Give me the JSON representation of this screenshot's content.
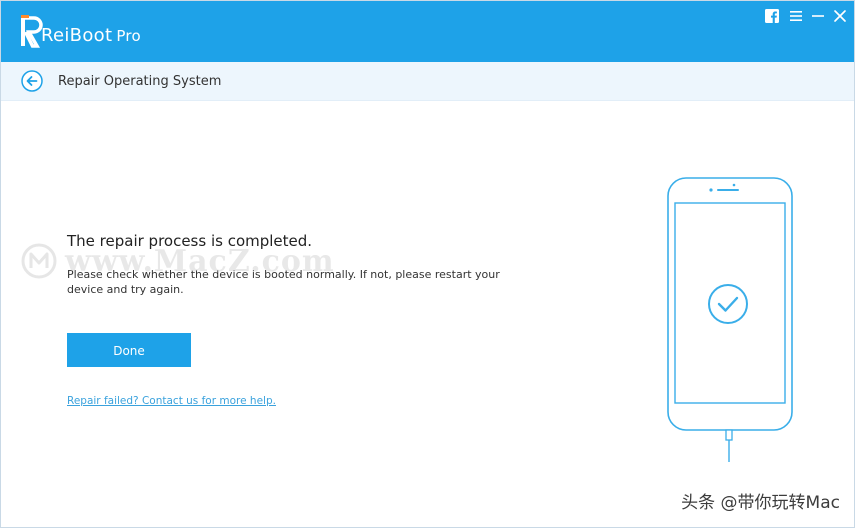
{
  "app": {
    "name": "ReiBoot",
    "edition": "Pro"
  },
  "window_controls": [
    {
      "name": "facebook-icon"
    },
    {
      "name": "menu-icon"
    },
    {
      "name": "minimize-icon"
    },
    {
      "name": "close-icon"
    }
  ],
  "header": {
    "back_icon": "arrow-left-icon",
    "title": "Repair Operating System"
  },
  "main": {
    "heading": "The repair process is completed.",
    "description": "Please check whether the device is booted normally. If not, please restart your device and try again.",
    "done_label": "Done",
    "help_link": "Repair failed? Contact us for more help."
  },
  "illustration": {
    "device": "phone",
    "status_icon": "check-circle-icon"
  },
  "watermarks": {
    "macz": "www.MacZ.com",
    "toutiao": "头条 @带你玩转Mac"
  },
  "colors": {
    "accent": "#1ea2e8",
    "header_bg": "#edf6fd",
    "link": "#3aa2dd"
  }
}
